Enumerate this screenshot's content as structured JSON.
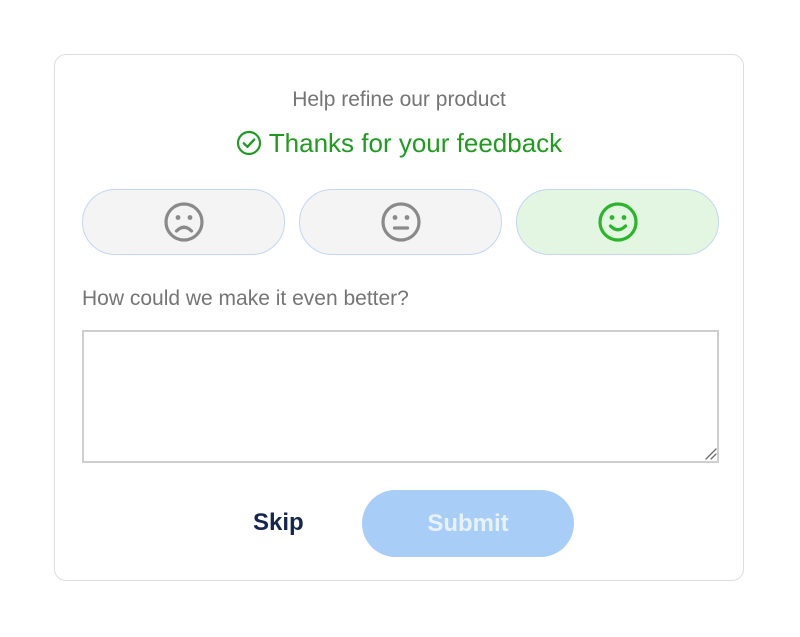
{
  "survey": {
    "subtitle": "Help refine our product",
    "confirmation": "Thanks for your feedback",
    "confirmation_color": "#1f9b1f",
    "ratings": [
      {
        "icon": "sad-face-icon",
        "selected": false
      },
      {
        "icon": "neutral-face-icon",
        "selected": false
      },
      {
        "icon": "happy-face-icon",
        "selected": true
      }
    ],
    "question": "How could we make it even better?",
    "feedback_value": "",
    "skip_label": "Skip",
    "submit_label": "Submit",
    "submit_color": "#a8cdf7"
  }
}
